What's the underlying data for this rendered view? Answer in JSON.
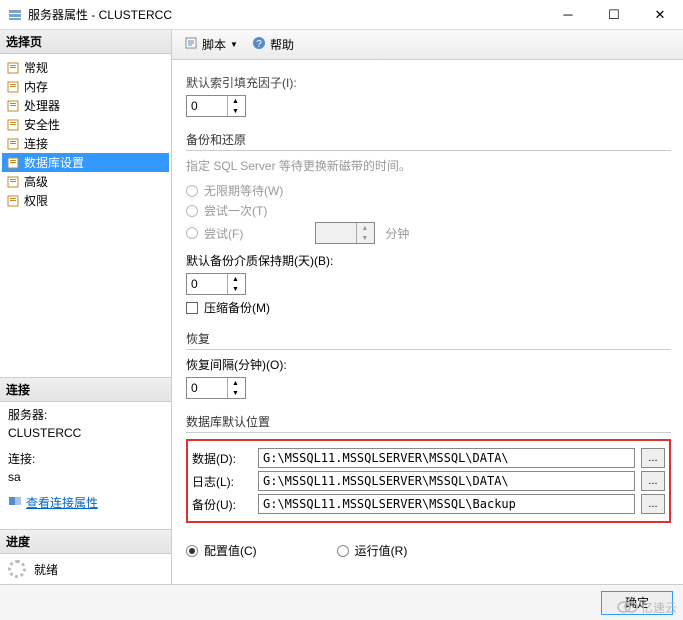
{
  "window": {
    "title": "服务器属性 - CLUSTERCC"
  },
  "left": {
    "select_page_header": "选择页",
    "tree": [
      {
        "label": "常规"
      },
      {
        "label": "内存"
      },
      {
        "label": "处理器"
      },
      {
        "label": "安全性"
      },
      {
        "label": "连接"
      },
      {
        "label": "数据库设置",
        "selected": true
      },
      {
        "label": "高级"
      },
      {
        "label": "权限"
      }
    ],
    "connection_header": "连接",
    "server_label": "服务器:",
    "server_value": "CLUSTERCC",
    "conn_label": "连接:",
    "conn_value": "sa",
    "view_conn_props": "查看连接属性",
    "progress_header": "进度",
    "progress_status": "就绪"
  },
  "toolbar": {
    "script": "脚本",
    "help": "帮助"
  },
  "form": {
    "fill_factor_label": "默认索引填充因子(I):",
    "fill_factor_value": "0",
    "backup_restore_header": "备份和还原",
    "tape_hint": "指定 SQL Server 等待更换新磁带的时间。",
    "wait_forever": "无限期等待(W)",
    "try_once": "尝试一次(T)",
    "try_label": "尝试(F)",
    "try_value": "",
    "minutes_suffix": "分钟",
    "media_retention_label": "默认备份介质保持期(天)(B):",
    "media_retention_value": "0",
    "compress_backup": "压缩备份(M)",
    "recovery_header": "恢复",
    "recovery_interval_label": "恢复间隔(分钟)(O):",
    "recovery_interval_value": "0",
    "db_default_loc_header": "数据库默认位置",
    "data_label": "数据(D):",
    "data_path": "G:\\MSSQL11.MSSQLSERVER\\MSSQL\\DATA\\",
    "log_label": "日志(L):",
    "log_path": "G:\\MSSQL11.MSSQLSERVER\\MSSQL\\DATA\\",
    "backup_label": "备份(U):",
    "backup_path": "G:\\MSSQL11.MSSQLSERVER\\MSSQL\\Backup",
    "configured": "配置值(C)",
    "running": "运行值(R)"
  },
  "footer": {
    "ok": "确定"
  },
  "watermark": "亿速云"
}
